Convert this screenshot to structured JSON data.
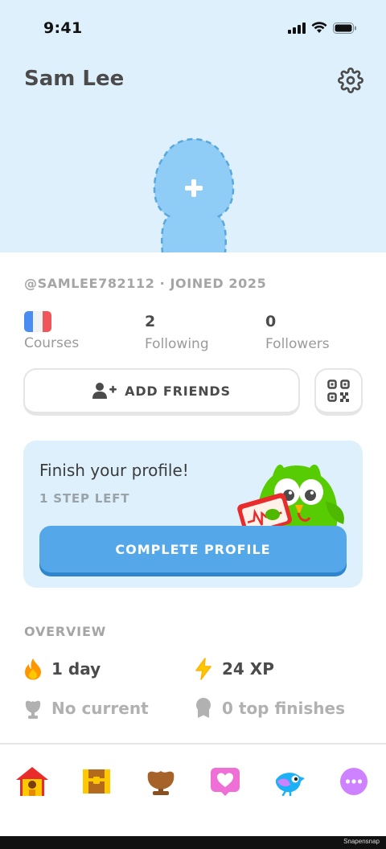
{
  "status_bar": {
    "time": "9:41"
  },
  "header": {
    "name": "Sam Lee"
  },
  "profile": {
    "handle_line": "@SAMLEE782112 · JOINED 2025",
    "stats": [
      {
        "value": "",
        "label": "Courses",
        "flag": "france"
      },
      {
        "value": "2",
        "label": "Following"
      },
      {
        "value": "0",
        "label": "Followers"
      }
    ]
  },
  "actions": {
    "add_friends_label": "ADD FRIENDS",
    "qr_icon": "qr-code-icon"
  },
  "complete_card": {
    "title": "Finish your profile!",
    "subtitle": "1 STEP LEFT",
    "button_label": "COMPLETE PROFILE"
  },
  "overview": {
    "title": "OVERVIEW",
    "items": [
      {
        "icon": "flame-icon",
        "text": "1 day"
      },
      {
        "icon": "lightning-icon",
        "text": "24 XP"
      },
      {
        "icon": "trophy-icon",
        "text": "No current"
      },
      {
        "icon": "medal-icon",
        "text": "0 top finishes"
      }
    ]
  },
  "tabs": [
    {
      "name": "home",
      "icon": "home-icon"
    },
    {
      "name": "chest",
      "icon": "treasure-chest-icon"
    },
    {
      "name": "leagues",
      "icon": "league-shield-icon"
    },
    {
      "name": "hearts",
      "icon": "heart-icon"
    },
    {
      "name": "characters",
      "icon": "bird-character-icon"
    },
    {
      "name": "more",
      "icon": "more-icon"
    }
  ],
  "footer": {
    "watermark": "Snapensnap"
  },
  "colors": {
    "hero_bg": "#ddf0fc",
    "primary_blue": "#54a8ea",
    "owl_green": "#58cc02",
    "flame": "#ff9600",
    "xp": "#ffc800"
  }
}
